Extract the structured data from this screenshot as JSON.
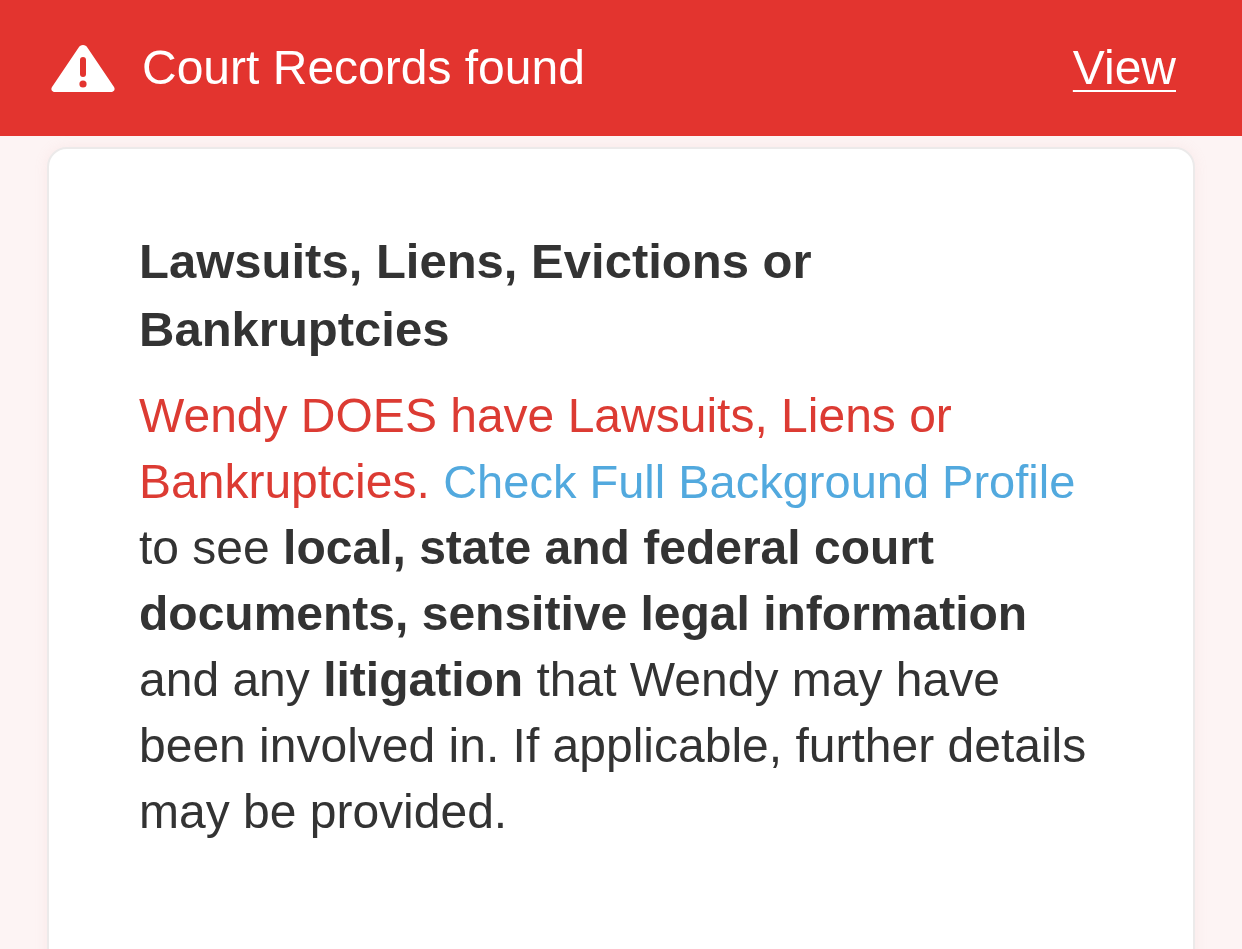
{
  "banner": {
    "title": "Court Records found",
    "link": "View"
  },
  "card": {
    "heading": "Lawsuits, Liens, Evictions or Bankruptcies",
    "alert": "Wendy DOES have Lawsuits, Liens or Bankruptcies.",
    "link": "Check Full Background Profile",
    "text": "to see **local, state and federal court documents, sensitive legal information** and any **litigation** that Wendy may have been involved in. If applicable, further details may be provided."
  }
}
